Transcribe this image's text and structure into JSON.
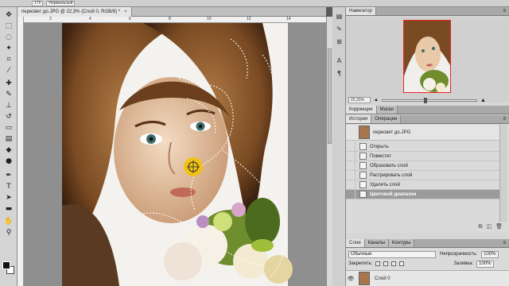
{
  "options": {
    "field1": "175",
    "field2": "Нормальный"
  },
  "document": {
    "tab_title": "пересвет до.JPG @ 22,3% (Слой 0, RGB/8) *",
    "close": "×"
  },
  "rulers": {
    "top": [
      "2",
      "4",
      "6",
      "8",
      "10",
      "12",
      "14"
    ]
  },
  "navigator": {
    "tab": "Навигатор",
    "zoom": "22,31%"
  },
  "corrections": {
    "tab1": "Коррекция",
    "tab2": "Маски"
  },
  "history": {
    "tab1": "История",
    "tab2": "Операции",
    "snapshot": "пересвет до.JPG",
    "items": [
      {
        "label": "Открыть"
      },
      {
        "label": "Поместит"
      },
      {
        "label": "Образовать слой"
      },
      {
        "label": "Растрировать слой"
      },
      {
        "label": "Удалить слой"
      },
      {
        "label": "Цветовой диапазон"
      }
    ]
  },
  "layers": {
    "tab1": "Слои",
    "tab2": "Каналы",
    "tab3": "Контуры",
    "blend_mode": "Обычные",
    "opacity_label": "Непрозрачность:",
    "opacity_value": "100%",
    "lock_label": "Закрепить:",
    "fill_label": "Заливка:",
    "fill_value": "100%",
    "layer_name": "Слой 0"
  },
  "colors": {
    "hair": "#7a4a23",
    "skin": "#e9c9a8",
    "flower_green": "#6f8d2d",
    "selection_bg": "#9a9a9a"
  },
  "icons": [
    "move-icon",
    "marquee-icon",
    "lasso-icon",
    "magic-wand-icon",
    "crop-icon",
    "eyedropper-icon",
    "healing-icon",
    "brush-icon",
    "stamp-icon",
    "history-brush-icon",
    "eraser-icon",
    "gradient-icon",
    "blur-icon",
    "dodge-icon",
    "pen-icon",
    "type-icon",
    "path-select-icon",
    "shape-icon",
    "hand-icon",
    "zoom-icon"
  ]
}
